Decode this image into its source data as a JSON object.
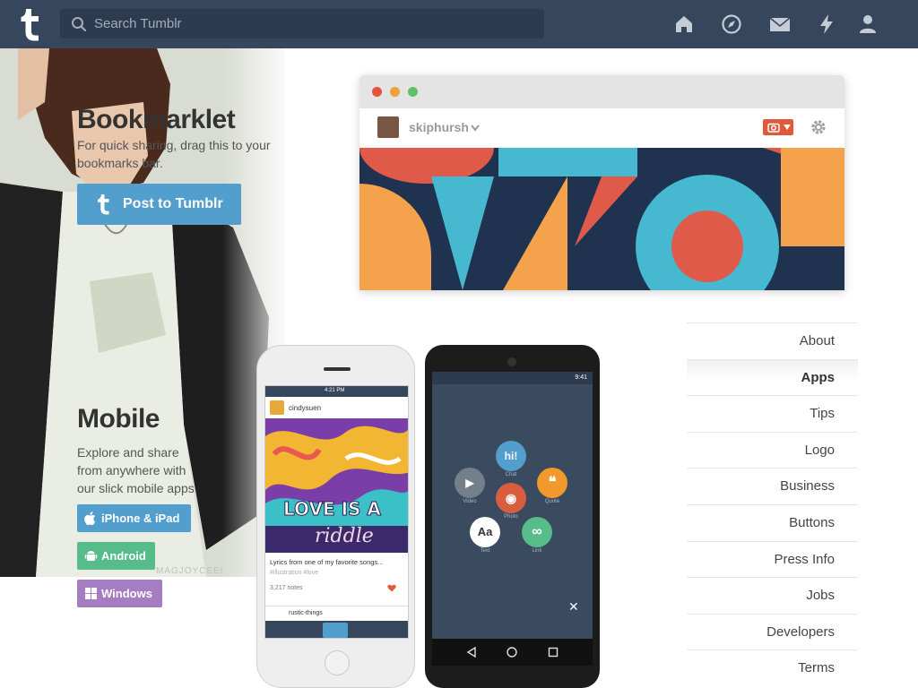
{
  "search": {
    "placeholder": "Search Tumblr"
  },
  "nav_icons": [
    "home-icon",
    "compass-icon",
    "mail-icon",
    "lightning-icon",
    "user-icon"
  ],
  "colors": {
    "topbar": "#36465d",
    "search_bg": "#2d3b50",
    "accent_blue": "#529ecc",
    "android_green": "#56bc8a",
    "windows_purple": "#a77dc2"
  },
  "bookmarklet": {
    "title": "Bookmarklet",
    "description_line1": "For quick sharing, drag this to your",
    "description_line2": "bookmarks bar.",
    "button_label": "Post to Tumblr"
  },
  "browser_mock": {
    "username": "skiphursh"
  },
  "mobile": {
    "title": "Mobile",
    "description_line1": "Explore and share",
    "description_line2": "from anywhere with",
    "description_line3": "our slick mobile apps.",
    "buttons": [
      {
        "label": "iPhone & iPad",
        "color": "#529ecc"
      },
      {
        "label": "Android",
        "color": "#56bc8a"
      },
      {
        "label": "Windows",
        "color": "#a77dc2"
      }
    ]
  },
  "iphone_screen": {
    "time": "4:21 PM",
    "username": "cindysuen",
    "art_text1": "LOVE IS A",
    "art_text2": "riddle",
    "caption": "Lyrics from one of my favorite songs...",
    "tags": "#illustration  #love",
    "notes": "3,217 notes",
    "next_user": "rustic-things"
  },
  "android_screen": {
    "time": "9:41",
    "bubbles": [
      {
        "glyph": "hi!",
        "label": "Chat",
        "color": "#529ecc"
      },
      {
        "glyph": "❝",
        "label": "Quote",
        "color": "#f2992e"
      },
      {
        "glyph": "◉",
        "label": "Photo",
        "color": "#d95e40"
      },
      {
        "glyph": "▶",
        "label": "Video",
        "color": "#748089"
      },
      {
        "glyph": "Aa",
        "label": "Text",
        "color": "#ffffff"
      },
      {
        "glyph": "∞",
        "label": "Link",
        "color": "#56bc8a"
      }
    ],
    "close": "✕"
  },
  "watermark": "MAGJOYCEE!",
  "side_menu": {
    "active": "Apps",
    "items": [
      "About",
      "Apps",
      "Tips",
      "Logo",
      "Business",
      "Buttons",
      "Press Info",
      "Jobs",
      "Developers",
      "Terms"
    ]
  }
}
